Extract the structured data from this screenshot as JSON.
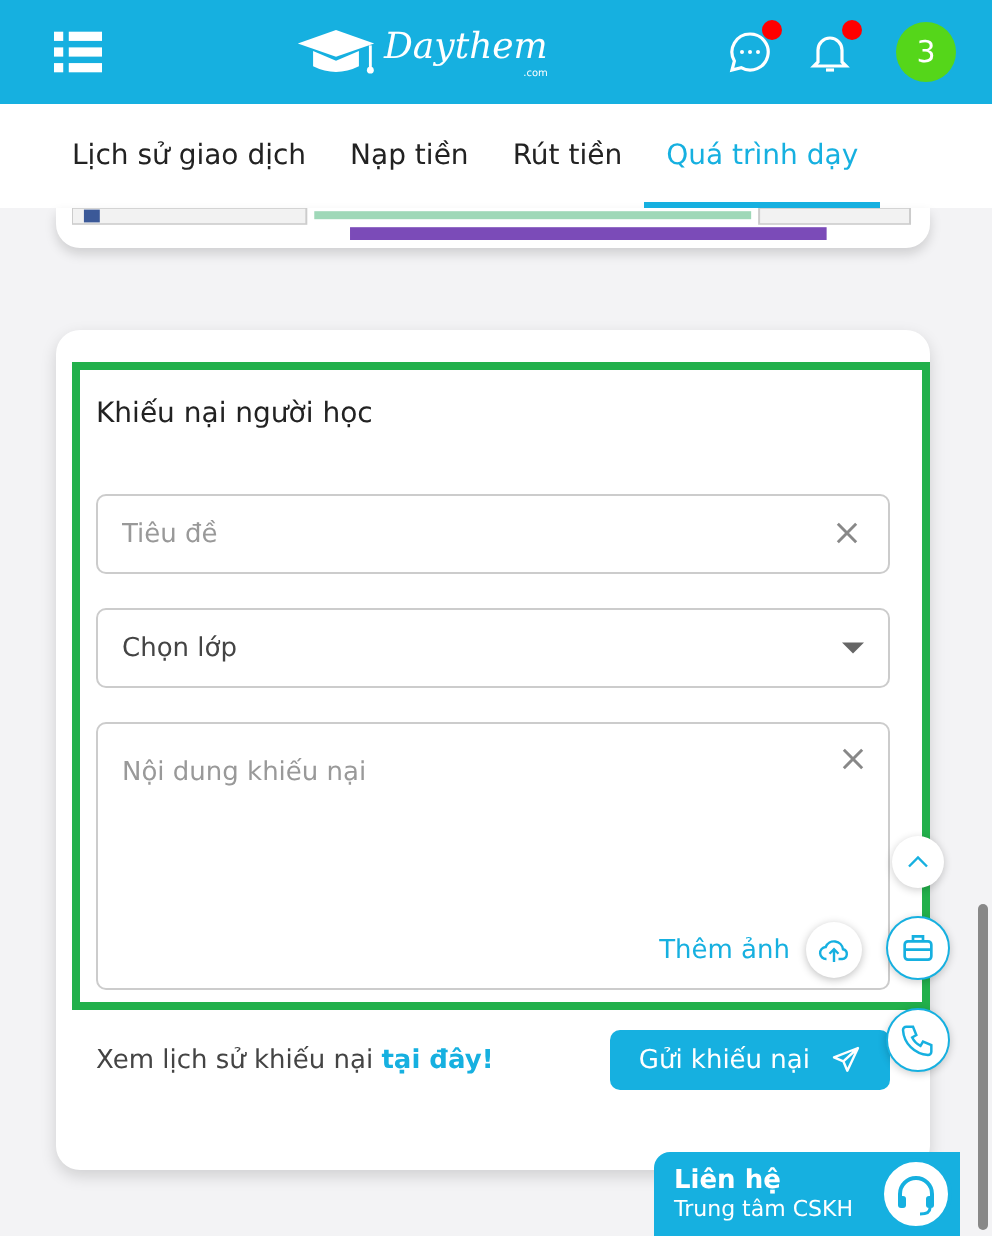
{
  "header": {
    "brand": "Daythem",
    "brand_sub": ".com",
    "messages_unread": true,
    "notifications_unread": true,
    "avatar": "3"
  },
  "tabs": [
    {
      "label": "Lịch sử giao dịch",
      "selected": false
    },
    {
      "label": "Nạp tiền",
      "selected": false
    },
    {
      "label": "Rút tiền",
      "selected": false
    },
    {
      "label": "Quá trình dạy",
      "selected": true
    }
  ],
  "complaint_form": {
    "title": "Khiếu nại người học",
    "title_placeholder": "Tiêu đề",
    "class_placeholder": "Chọn lớp",
    "content_placeholder": "Nội dung khiếu nại",
    "add_image": "Thêm ảnh",
    "history_text": "Xem lịch sử khiếu nại ",
    "history_link": "tại đây!",
    "submit": "Gửi khiếu nại"
  },
  "contact": {
    "title": "Liên hệ",
    "subtitle": "Trung tâm CSKH"
  }
}
